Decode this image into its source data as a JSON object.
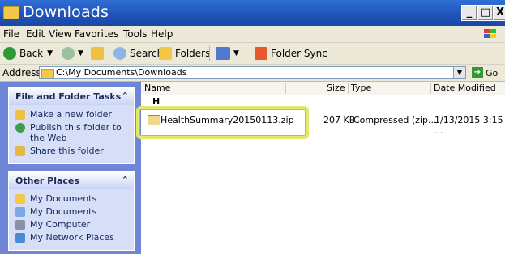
{
  "window": {
    "title": "Downloads"
  },
  "window_controls": {
    "minimize": "_",
    "maximize": "□",
    "close": "X"
  },
  "menu": [
    {
      "label": "File",
      "accel": "F"
    },
    {
      "label": "Edit",
      "accel": "E"
    },
    {
      "label": "View",
      "accel": "V"
    },
    {
      "label": "Favorites",
      "accel": "a"
    },
    {
      "label": "Tools",
      "accel": "T"
    },
    {
      "label": "Help",
      "accel": "H"
    }
  ],
  "toolbar": {
    "back_label": "Back",
    "search_label": "Search",
    "folders_label": "Folders",
    "folder_sync_label": "Folder Sync"
  },
  "address": {
    "label": "Address",
    "value": "C:\\My Documents\\Downloads",
    "go_label": "Go"
  },
  "tasks_panel": {
    "title": "File and Folder Tasks",
    "items": [
      "Make a new folder",
      "Publish this folder to the Web",
      "Share this folder"
    ]
  },
  "places_panel": {
    "title": "Other Places",
    "items": [
      "My Documents",
      "My Documents",
      "My Computer",
      "My Network Places"
    ]
  },
  "columns": {
    "name": "Name",
    "size": "Size",
    "type": "Type",
    "date": "Date Modified"
  },
  "group_label": "H",
  "files": [
    {
      "name": "HealthSummary20150113.zip",
      "size": "207 KB",
      "type": "Compressed (zip...",
      "date": "1/13/2015 3:15 ..."
    }
  ],
  "colors": {
    "titlebar": "#1f52b8",
    "sidepane": "#6f86d6",
    "highlight": "#e2e86a"
  }
}
